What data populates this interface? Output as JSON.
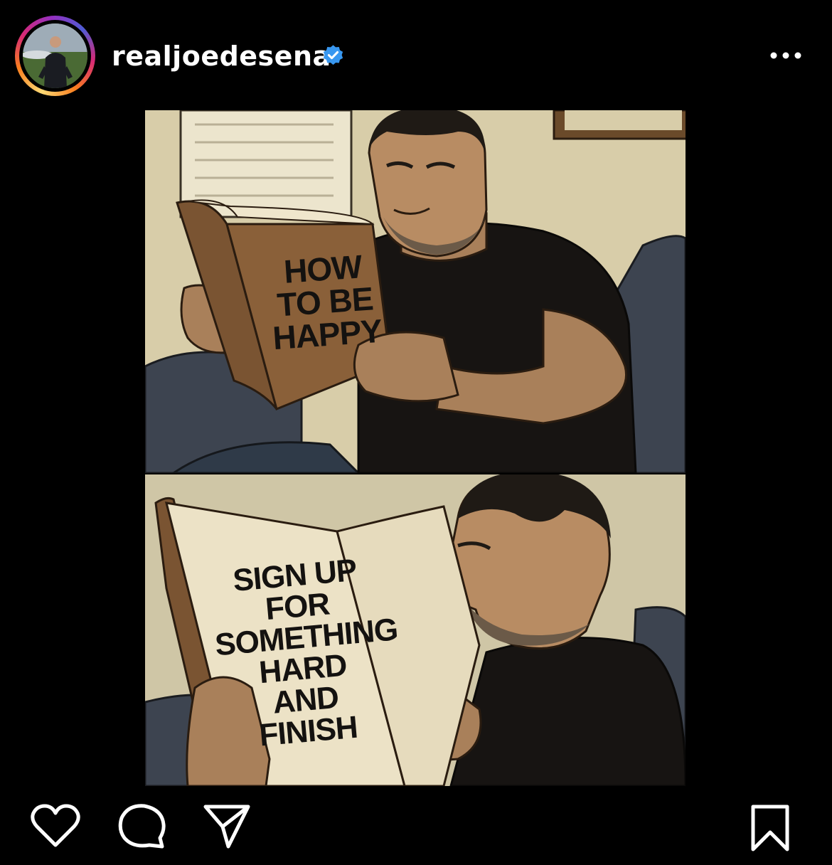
{
  "post": {
    "username": "realjoedesena",
    "verified": true
  },
  "meme": {
    "top_book_title": "HOW\nTO BE\nHAPPY",
    "bottom_page_text": "SIGN UP\nFOR\nSOMETHING\nHARD\nAND\nFINISH"
  },
  "icons": {
    "verified": "verified-badge-icon",
    "more": "more-options-icon",
    "like": "heart-icon",
    "comment": "comment-icon",
    "share": "send-icon",
    "save": "bookmark-icon"
  },
  "colors": {
    "background": "#000000",
    "verified_blue": "#3897f0",
    "story_ring_start": "#feda75",
    "story_ring_end": "#962fbf"
  }
}
